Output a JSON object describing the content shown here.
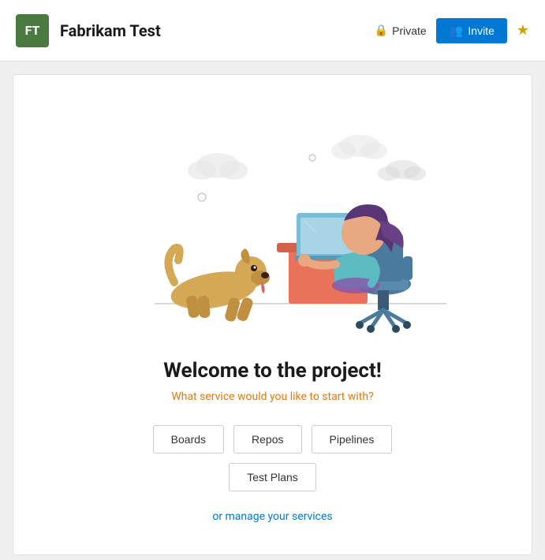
{
  "header": {
    "avatar_text": "FT",
    "avatar_bg": "#4a7a3f",
    "project_title": "Fabrikam Test",
    "private_label": "Private",
    "invite_label": "Invite",
    "star_icon": "★"
  },
  "main": {
    "welcome_title": "Welcome to the project!",
    "welcome_subtitle": "What service would you like to start with?",
    "service_buttons_row1": [
      "Boards",
      "Repos",
      "Pipelines"
    ],
    "service_buttons_row2": [
      "Test Plans"
    ],
    "manage_link": "or manage your services"
  }
}
